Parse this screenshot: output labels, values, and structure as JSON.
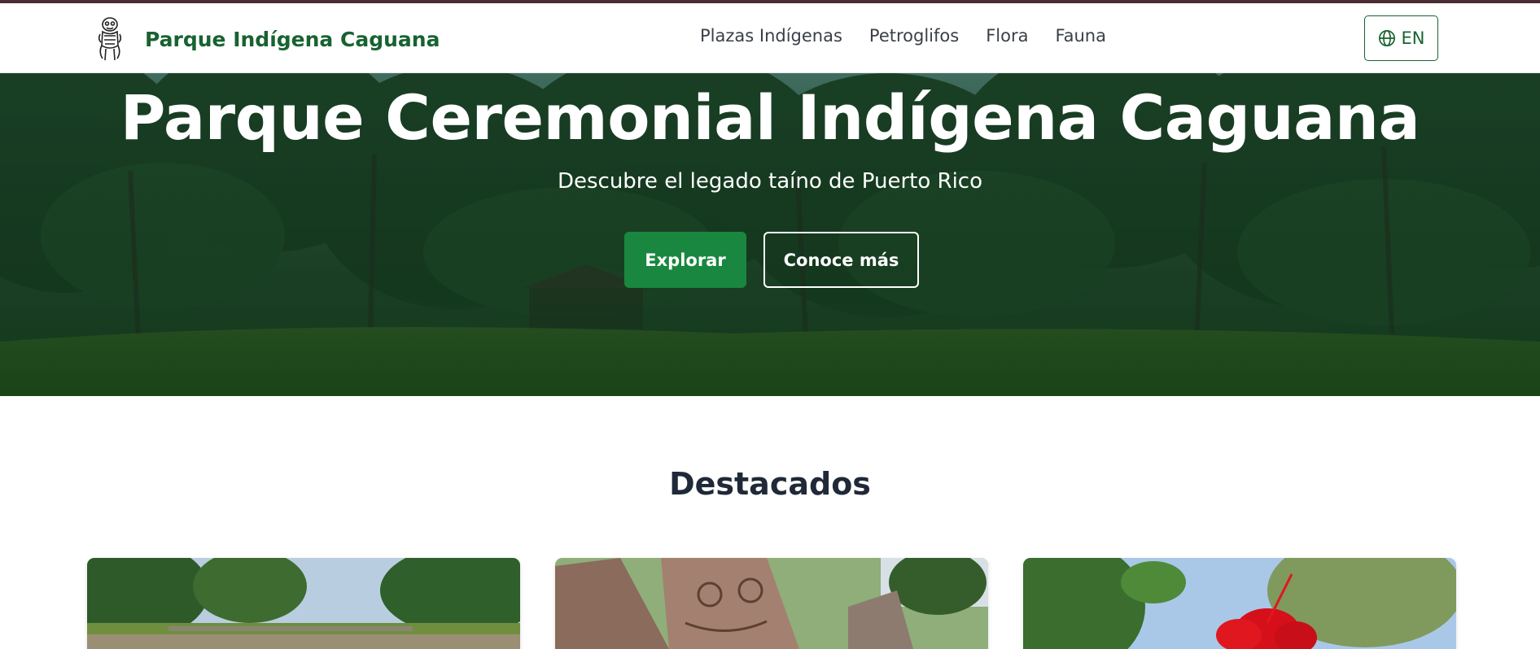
{
  "header": {
    "brand_name": "Parque Indígena Caguana",
    "logo_icon": "taino-figure-icon",
    "nav_links": [
      {
        "label": "Plazas Indígenas"
      },
      {
        "label": "Petroglifos"
      },
      {
        "label": "Flora"
      },
      {
        "label": "Fauna"
      }
    ],
    "language_button": {
      "label": "EN",
      "icon": "globe-icon"
    }
  },
  "hero": {
    "title": "Parque Ceremonial Indígena Caguana",
    "subtitle": "Descubre el legado taíno de Puerto Rico",
    "primary_button": "Explorar",
    "secondary_button": "Conoce más"
  },
  "featured": {
    "title": "Destacados",
    "cards": [
      {
        "image": "plaza-landscape-image"
      },
      {
        "image": "petroglyph-stone-image"
      },
      {
        "image": "red-hibiscus-flower-image"
      }
    ]
  },
  "colors": {
    "brand_green": "#176331",
    "button_green": "#19873f",
    "top_bar": "#4b2b33",
    "heading_dark": "#1f2937"
  }
}
